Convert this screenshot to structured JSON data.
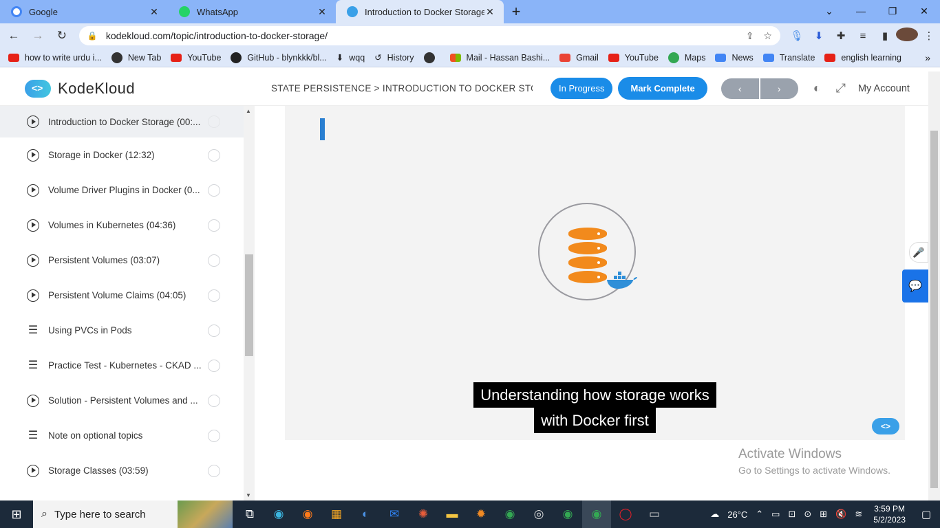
{
  "browser": {
    "tabs": [
      {
        "title": "Google",
        "color": "#4285f4"
      },
      {
        "title": "WhatsApp",
        "color": "#25d366"
      },
      {
        "title": "Introduction to Docker Storage -",
        "color": "#3aa0e8"
      }
    ],
    "url": "kodekloud.com/topic/introduction-to-docker-storage/",
    "bookmarks": [
      {
        "label": "how to write urdu i...",
        "color": "#e62117",
        "icon": "youtube-icon"
      },
      {
        "label": "New Tab",
        "color": "#333333",
        "icon": "globe-icon"
      },
      {
        "label": "YouTube",
        "color": "#e62117",
        "icon": "youtube-icon"
      },
      {
        "label": "GitHub - blynkkk/bl...",
        "color": "#222222",
        "icon": "github-icon"
      },
      {
        "label": "wqq",
        "color": "#333333",
        "icon": "download-icon"
      },
      {
        "label": "History",
        "color": "#333333",
        "icon": "history-icon"
      },
      {
        "label": "",
        "color": "#333333",
        "icon": "globe-icon"
      },
      {
        "label": "Mail - Hassan Bashi...",
        "color": "#0078d4",
        "icon": "microsoft-icon"
      },
      {
        "label": "Gmail",
        "color": "#ea4335",
        "icon": "gmail-icon"
      },
      {
        "label": "YouTube",
        "color": "#e62117",
        "icon": "youtube-icon"
      },
      {
        "label": "Maps",
        "color": "#34a853",
        "icon": "maps-icon"
      },
      {
        "label": "News",
        "color": "#4285f4",
        "icon": "news-icon"
      },
      {
        "label": "Translate",
        "color": "#4285f4",
        "icon": "translate-icon"
      },
      {
        "label": "english learning",
        "color": "#e62117",
        "icon": "youtube-icon"
      }
    ]
  },
  "header": {
    "logo_text": "KodeKloud",
    "breadcrumb": "STATE PERSISTENCE > INTRODUCTION TO DOCKER STOR...",
    "in_progress": "In Progress",
    "mark_complete": "Mark Complete",
    "my_account": "My Account"
  },
  "sidebar": {
    "lessons": [
      {
        "label": "Introduction to Docker Storage (00:...",
        "type": "video",
        "current": true
      },
      {
        "label": "Storage in Docker (12:32)",
        "type": "video"
      },
      {
        "label": "Volume Driver Plugins in Docker (0...",
        "type": "video"
      },
      {
        "label": "Volumes in Kubernetes (04:36)",
        "type": "video"
      },
      {
        "label": "Persistent Volumes (03:07)",
        "type": "video"
      },
      {
        "label": "Persistent Volume Claims (04:05)",
        "type": "video"
      },
      {
        "label": "Using PVCs in Pods",
        "type": "text"
      },
      {
        "label": "Practice Test - Kubernetes - CKAD ...",
        "type": "text"
      },
      {
        "label": "Solution - Persistent Volumes and ...",
        "type": "video"
      },
      {
        "label": "Note on optional topics",
        "type": "text"
      },
      {
        "label": "Storage Classes (03:59)",
        "type": "video"
      }
    ]
  },
  "video": {
    "caption_line1": "Understanding how storage works",
    "caption_line2": "with Docker first",
    "accent_color": "#f28a1c"
  },
  "watermark": {
    "line1": "Activate Windows",
    "line2": "Go to Settings to activate Windows."
  },
  "taskbar": {
    "search_placeholder": "Type here to search",
    "temperature": "26°C",
    "time": "3:59 PM",
    "date": "5/2/2023"
  }
}
